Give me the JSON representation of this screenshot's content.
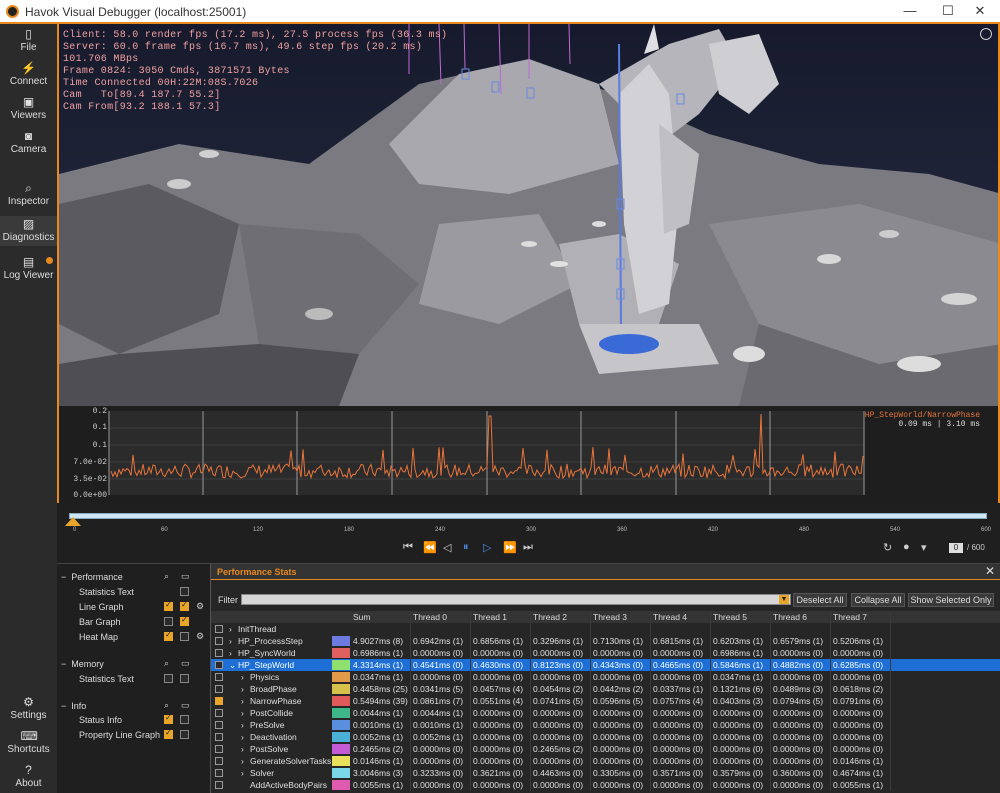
{
  "window": {
    "title": "Havok Visual Debugger (localhost:25001)",
    "min": "—",
    "max": "☐",
    "close": "✕"
  },
  "colors": {
    "accent": "#e8891e",
    "selection": "#1d6fd6",
    "overlay_text": "#f0a0a0",
    "graph_line": "#e8743b"
  },
  "sidebar": {
    "items": [
      {
        "label": "File",
        "icon": "file-icon"
      },
      {
        "label": "Connect",
        "icon": "connect-icon"
      },
      {
        "label": "Viewers",
        "icon": "viewers-icon"
      },
      {
        "label": "Camera",
        "icon": "camera-icon"
      },
      {
        "label": "Inspector",
        "icon": "inspector-icon"
      },
      {
        "label": "Diagnostics",
        "icon": "diagnostics-icon"
      },
      {
        "label": "Log Viewer",
        "icon": "log-viewer-icon"
      },
      {
        "label": "Settings",
        "icon": "gear-icon"
      },
      {
        "label": "Shortcuts",
        "icon": "keyboard-icon"
      },
      {
        "label": "About",
        "icon": "question-icon"
      }
    ]
  },
  "overlay": {
    "line1": "Client: 58.0 render fps (17.2 ms), 27.5 process fps (36.3 ms)",
    "line2": "Server: 60.0 frame fps (16.7 ms), 49.6 step fps (20.2 ms)",
    "line3": "101.706 MBps",
    "line4": "Frame 0824: 3050 Cmds, 3871571 Bytes",
    "line5": "Time Connected 00H:22M:08S.7026",
    "line6": "Cam   To[89.4 187.7 55.2]",
    "line7": "Cam From[93.2 188.1 57.3]"
  },
  "graph": {
    "y_labels": [
      "0.2",
      "0.1",
      "0.1",
      "7.0e-02",
      "3.5e-02",
      "0.0e+00"
    ],
    "legend_name": "HP_StepWorld/NarrowPhase",
    "legend_values": "0.09 ms | 3.10 ms"
  },
  "timeline": {
    "ticks": [
      "0",
      "60",
      "120",
      "180",
      "240",
      "300",
      "360",
      "420",
      "480",
      "540",
      "600"
    ],
    "current_frame": "0",
    "total_frames": "/ 600"
  },
  "perf_options": {
    "performance": {
      "title": "Performance",
      "items": [
        "Statistics Text",
        "Line Graph",
        "Bar Graph",
        "Heat Map"
      ]
    },
    "memory": {
      "title": "Memory",
      "items": [
        "Statistics Text"
      ]
    },
    "info": {
      "title": "Info",
      "items": [
        "Status Info",
        "Property Line Graph"
      ]
    }
  },
  "stats": {
    "title": "Performance Stats",
    "filter_label": "Filter",
    "buttons": {
      "deselect": "Deselect All",
      "collapse": "Collapse All",
      "show_selected": "Show Selected Only"
    },
    "columns": [
      "Sum",
      "Thread 0",
      "Thread 1",
      "Thread 2",
      "Thread 3",
      "Thread 4",
      "Thread 5",
      "Thread 6",
      "Thread 7"
    ],
    "rows": [
      {
        "name": "InitThread",
        "level": 0,
        "arrow": "›",
        "checked": false,
        "color": "",
        "cells": [
          "",
          "",
          "",
          "",
          "",
          "",
          "",
          "",
          ""
        ]
      },
      {
        "name": "HP_ProcessStep",
        "level": 0,
        "arrow": "›",
        "checked": false,
        "color": "#6b7be0",
        "cells": [
          "4.9027ms (8)",
          "0.6942ms (1)",
          "0.6856ms (1)",
          "0.3296ms (1)",
          "0.7130ms (1)",
          "0.6815ms (1)",
          "0.6203ms (1)",
          "0.6579ms (1)",
          "0.5206ms (1)"
        ]
      },
      {
        "name": "HP_SyncWorld",
        "level": 0,
        "arrow": "›",
        "checked": false,
        "color": "#e06060",
        "cells": [
          "0.6986ms (1)",
          "0.0000ms (0)",
          "0.0000ms (0)",
          "0.0000ms (0)",
          "0.0000ms (0)",
          "0.0000ms (0)",
          "0.6986ms (1)",
          "0.0000ms (0)",
          "0.0000ms (0)"
        ]
      },
      {
        "name": "HP_StepWorld",
        "level": 0,
        "arrow": "⌄",
        "checked": false,
        "color": "#8fe06e",
        "selected": true,
        "cells": [
          "4.3314ms (1)",
          "0.4541ms (0)",
          "0.4630ms (0)",
          "0.8123ms (0)",
          "0.4343ms (0)",
          "0.4665ms (0)",
          "0.5846ms (1)",
          "0.4882ms (0)",
          "0.6285ms (0)"
        ]
      },
      {
        "name": "Physics",
        "level": 1,
        "arrow": "›",
        "checked": false,
        "color": "#e09a4a",
        "cells": [
          "0.0347ms (1)",
          "0.0000ms (0)",
          "0.0000ms (0)",
          "0.0000ms (0)",
          "0.0000ms (0)",
          "0.0000ms (0)",
          "0.0347ms (1)",
          "0.0000ms (0)",
          "0.0000ms (0)"
        ]
      },
      {
        "name": "BroadPhase",
        "level": 1,
        "arrow": "›",
        "checked": false,
        "color": "#d6c24a",
        "cells": [
          "0.4458ms (25)",
          "0.0341ms (5)",
          "0.0457ms (4)",
          "0.0454ms (2)",
          "0.0442ms (2)",
          "0.0337ms (1)",
          "0.1321ms (6)",
          "0.0489ms (3)",
          "0.0618ms (2)"
        ]
      },
      {
        "name": "NarrowPhase",
        "level": 1,
        "arrow": "›",
        "checked": true,
        "color": "#e05a5a",
        "cells": [
          "0.5494ms (39)",
          "0.0861ms (7)",
          "0.0551ms (4)",
          "0.0741ms (5)",
          "0.0596ms (5)",
          "0.0757ms (4)",
          "0.0403ms (3)",
          "0.0794ms (5)",
          "0.0791ms (6)"
        ]
      },
      {
        "name": "PostCollide",
        "level": 1,
        "arrow": "›",
        "checked": false,
        "color": "#3fb58a",
        "cells": [
          "0.0044ms (1)",
          "0.0044ms (1)",
          "0.0000ms (0)",
          "0.0000ms (0)",
          "0.0000ms (0)",
          "0.0000ms (0)",
          "0.0000ms (0)",
          "0.0000ms (0)",
          "0.0000ms (0)"
        ]
      },
      {
        "name": "PreSolve",
        "level": 1,
        "arrow": "›",
        "checked": false,
        "color": "#5a8fe0",
        "cells": [
          "0.0010ms (1)",
          "0.0010ms (1)",
          "0.0000ms (0)",
          "0.0000ms (0)",
          "0.0000ms (0)",
          "0.0000ms (0)",
          "0.0000ms (0)",
          "0.0000ms (0)",
          "0.0000ms (0)"
        ]
      },
      {
        "name": "Deactivation",
        "level": 1,
        "arrow": "›",
        "checked": false,
        "color": "#4ab0d6",
        "cells": [
          "0.0052ms (1)",
          "0.0052ms (1)",
          "0.0000ms (0)",
          "0.0000ms (0)",
          "0.0000ms (0)",
          "0.0000ms (0)",
          "0.0000ms (0)",
          "0.0000ms (0)",
          "0.0000ms (0)"
        ]
      },
      {
        "name": "PostSolve",
        "level": 1,
        "arrow": "›",
        "checked": false,
        "color": "#c45ad6",
        "cells": [
          "0.2465ms (2)",
          "0.0000ms (0)",
          "0.0000ms (0)",
          "0.2465ms (2)",
          "0.0000ms (0)",
          "0.0000ms (0)",
          "0.0000ms (0)",
          "0.0000ms (0)",
          "0.0000ms (0)"
        ]
      },
      {
        "name": "GenerateSolverTasks",
        "level": 1,
        "arrow": "›",
        "checked": false,
        "color": "#e8e05a",
        "cells": [
          "0.0146ms (1)",
          "0.0000ms (0)",
          "0.0000ms (0)",
          "0.0000ms (0)",
          "0.0000ms (0)",
          "0.0000ms (0)",
          "0.0000ms (0)",
          "0.0000ms (0)",
          "0.0146ms (1)"
        ]
      },
      {
        "name": "Solver",
        "level": 1,
        "arrow": "›",
        "checked": false,
        "color": "#7ad6e8",
        "cells": [
          "3.0046ms (3)",
          "0.3233ms (0)",
          "0.3621ms (0)",
          "0.4463ms (0)",
          "0.3305ms (0)",
          "0.3571ms (0)",
          "0.3579ms (0)",
          "0.3600ms (0)",
          "0.4674ms (1)"
        ]
      },
      {
        "name": "AddActiveBodyPairs",
        "level": 1,
        "arrow": "",
        "checked": false,
        "color": "#e05ab0",
        "cells": [
          "0.0055ms (1)",
          "0.0000ms (0)",
          "0.0000ms (0)",
          "0.0000ms (0)",
          "0.0000ms (0)",
          "0.0000ms (0)",
          "0.0000ms (0)",
          "0.0000ms (0)",
          "0.0055ms (1)"
        ]
      }
    ]
  }
}
